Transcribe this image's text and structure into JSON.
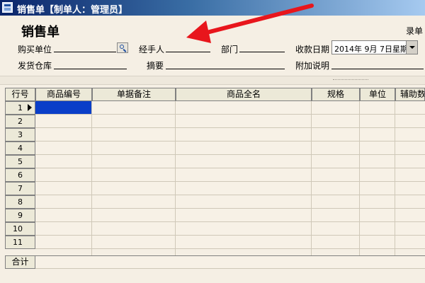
{
  "window": {
    "title": "销售单【制单人：管理员】"
  },
  "form": {
    "title": "销售单",
    "enter_label": "录单"
  },
  "fields": {
    "buyer": {
      "label": "购买单位",
      "value": ""
    },
    "handler": {
      "label": "经手人",
      "value": ""
    },
    "department": {
      "label": "部门",
      "value": ""
    },
    "payment_date": {
      "label": "收款日期",
      "value": "2014年  9月  7日星期"
    },
    "warehouse": {
      "label": "发货仓库",
      "value": ""
    },
    "summary": {
      "label": "摘要",
      "value": ""
    },
    "note": {
      "label": "附加说明",
      "value": ""
    }
  },
  "grid": {
    "columns": [
      "行号",
      "商品编号",
      "单据备注",
      "商品全名",
      "规格",
      "单位",
      "辅助数"
    ],
    "rows": [
      "1",
      "2",
      "3",
      "4",
      "5",
      "6",
      "7",
      "8",
      "9",
      "10",
      "11"
    ],
    "selected_row": 1,
    "total_label": "合计"
  },
  "annotation": {
    "color": "#e8161c"
  },
  "colors": {
    "selection": "#0a3ec8",
    "background": "#f5efe4"
  }
}
